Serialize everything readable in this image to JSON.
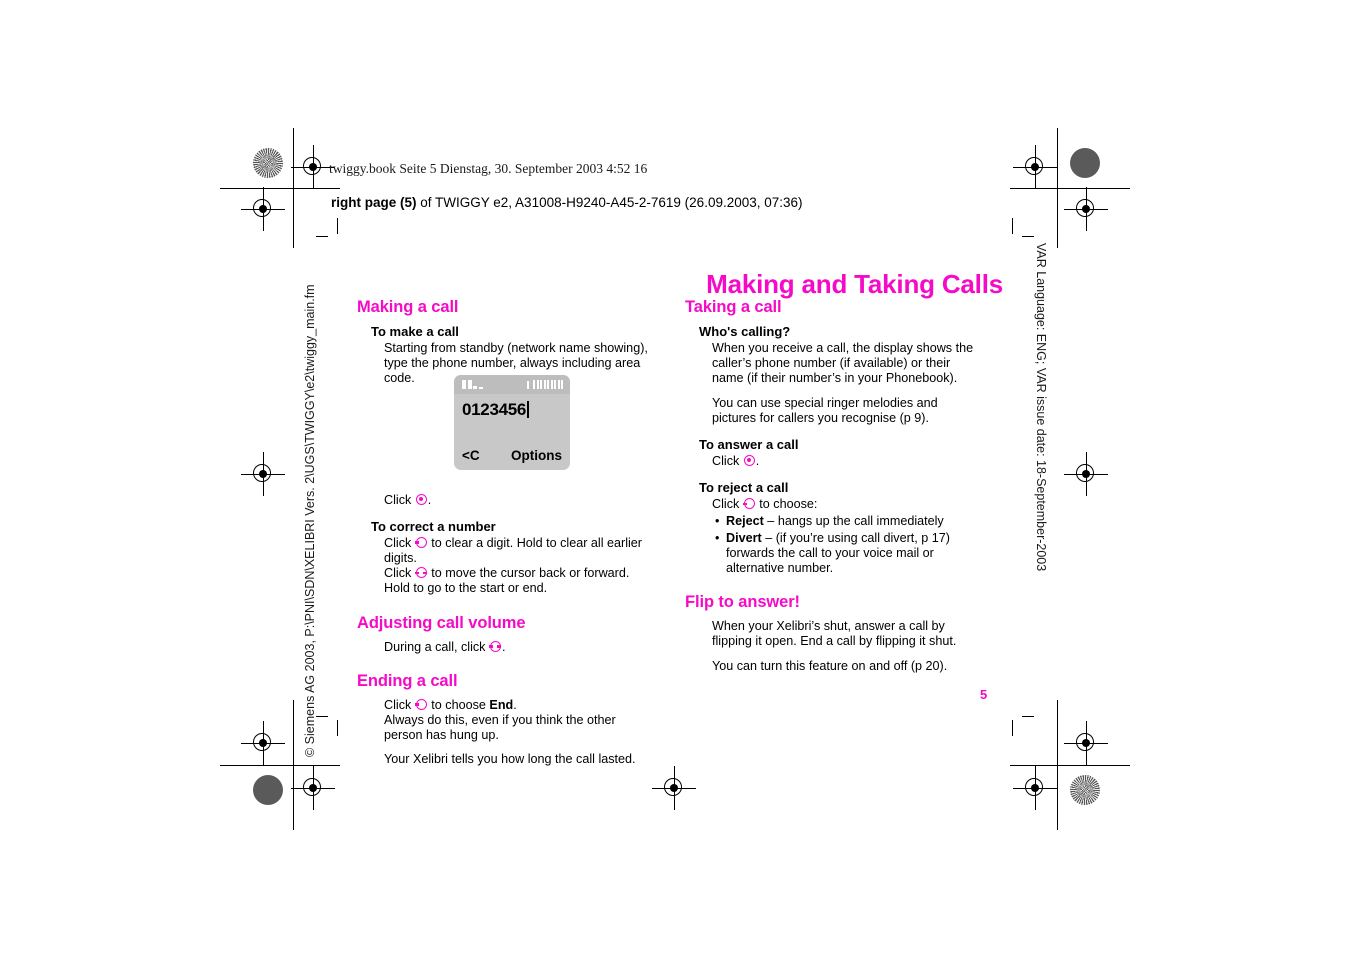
{
  "print_marks": {
    "file_stamp": "twiggy.book  Seite 5  Dienstag, 30. September 2003  4:52 16",
    "doc_line_bold": "right page (5)",
    "doc_line_rest": " of TWIGGY e2, A31008-H9240-A45-2-7619 (26.09.2003, 07:36)",
    "side_text_left": "© Siemens AG 2003, P:\\PNI\\SDN\\XELIBRI Vers. 2\\UGS\\TWIGGY\\e2\\twiggy_main.fm",
    "side_text_right": "VAR Language: ENG; VAR issue date: 18-September-2003"
  },
  "page": {
    "title": "Making and Taking Calls",
    "number": "5",
    "accent_color": "#f50ac8"
  },
  "left_column": {
    "section_making": {
      "heading": "Making a call",
      "sub_make": {
        "heading": "To make a call",
        "text": "Starting from standby (network name showing), type the phone number, always including area code."
      },
      "click_prefix": "Click",
      "click_suffix": ".",
      "sub_correct": {
        "heading": "To correct a number",
        "line1_prefix": "Click",
        "line1_text": "to clear a digit. Hold to clear all earlier digits.",
        "line2_prefix": "Click",
        "line2_text": "to move the cursor back or forward. Hold to go to the start or end."
      }
    },
    "section_volume": {
      "heading": "Adjusting call volume",
      "line_prefix": "During a call, click",
      "line_suffix": "."
    },
    "section_ending": {
      "heading": "Ending a call",
      "line1_prefix": "Click",
      "line1_mid": "to choose",
      "line1_bold": "End",
      "line1_suffix": ".",
      "line2": "Always do this, even if you think the other person has hung up.",
      "line3": "Your Xelibri tells you how long the call lasted."
    }
  },
  "right_column": {
    "section_taking": {
      "heading": "Taking a call",
      "sub_who": {
        "heading": "Who's calling?",
        "para1": "When you receive a call, the display shows the caller’s phone number (if available) or their name (if their number’s in your Phonebook).",
        "para2": "You can use special ringer melodies and pictures for callers you recognise (p 9)."
      },
      "sub_answer": {
        "heading": "To answer a call",
        "click_prefix": "Click",
        "click_suffix": "."
      },
      "sub_reject": {
        "heading": "To reject a call",
        "click_prefix": "Click",
        "click_suffix": "to choose:",
        "bullets": [
          {
            "bold": "Reject",
            "text": " – hangs up the call immediately"
          },
          {
            "bold": "Divert",
            "text": " – (if you’re using call divert, p 17) forwards the call to your voice mail or alternative number."
          }
        ]
      }
    },
    "section_flip": {
      "heading": "Flip to answer!",
      "para1": "When your Xelibri’s shut, answer a call by flipping it open. End a call by flipping it shut.",
      "para2": "You can turn this feature on and off (p 20)."
    }
  },
  "phone_figure": {
    "number_display": "0123456",
    "softkey_left": "<C",
    "softkey_right": "Options"
  }
}
